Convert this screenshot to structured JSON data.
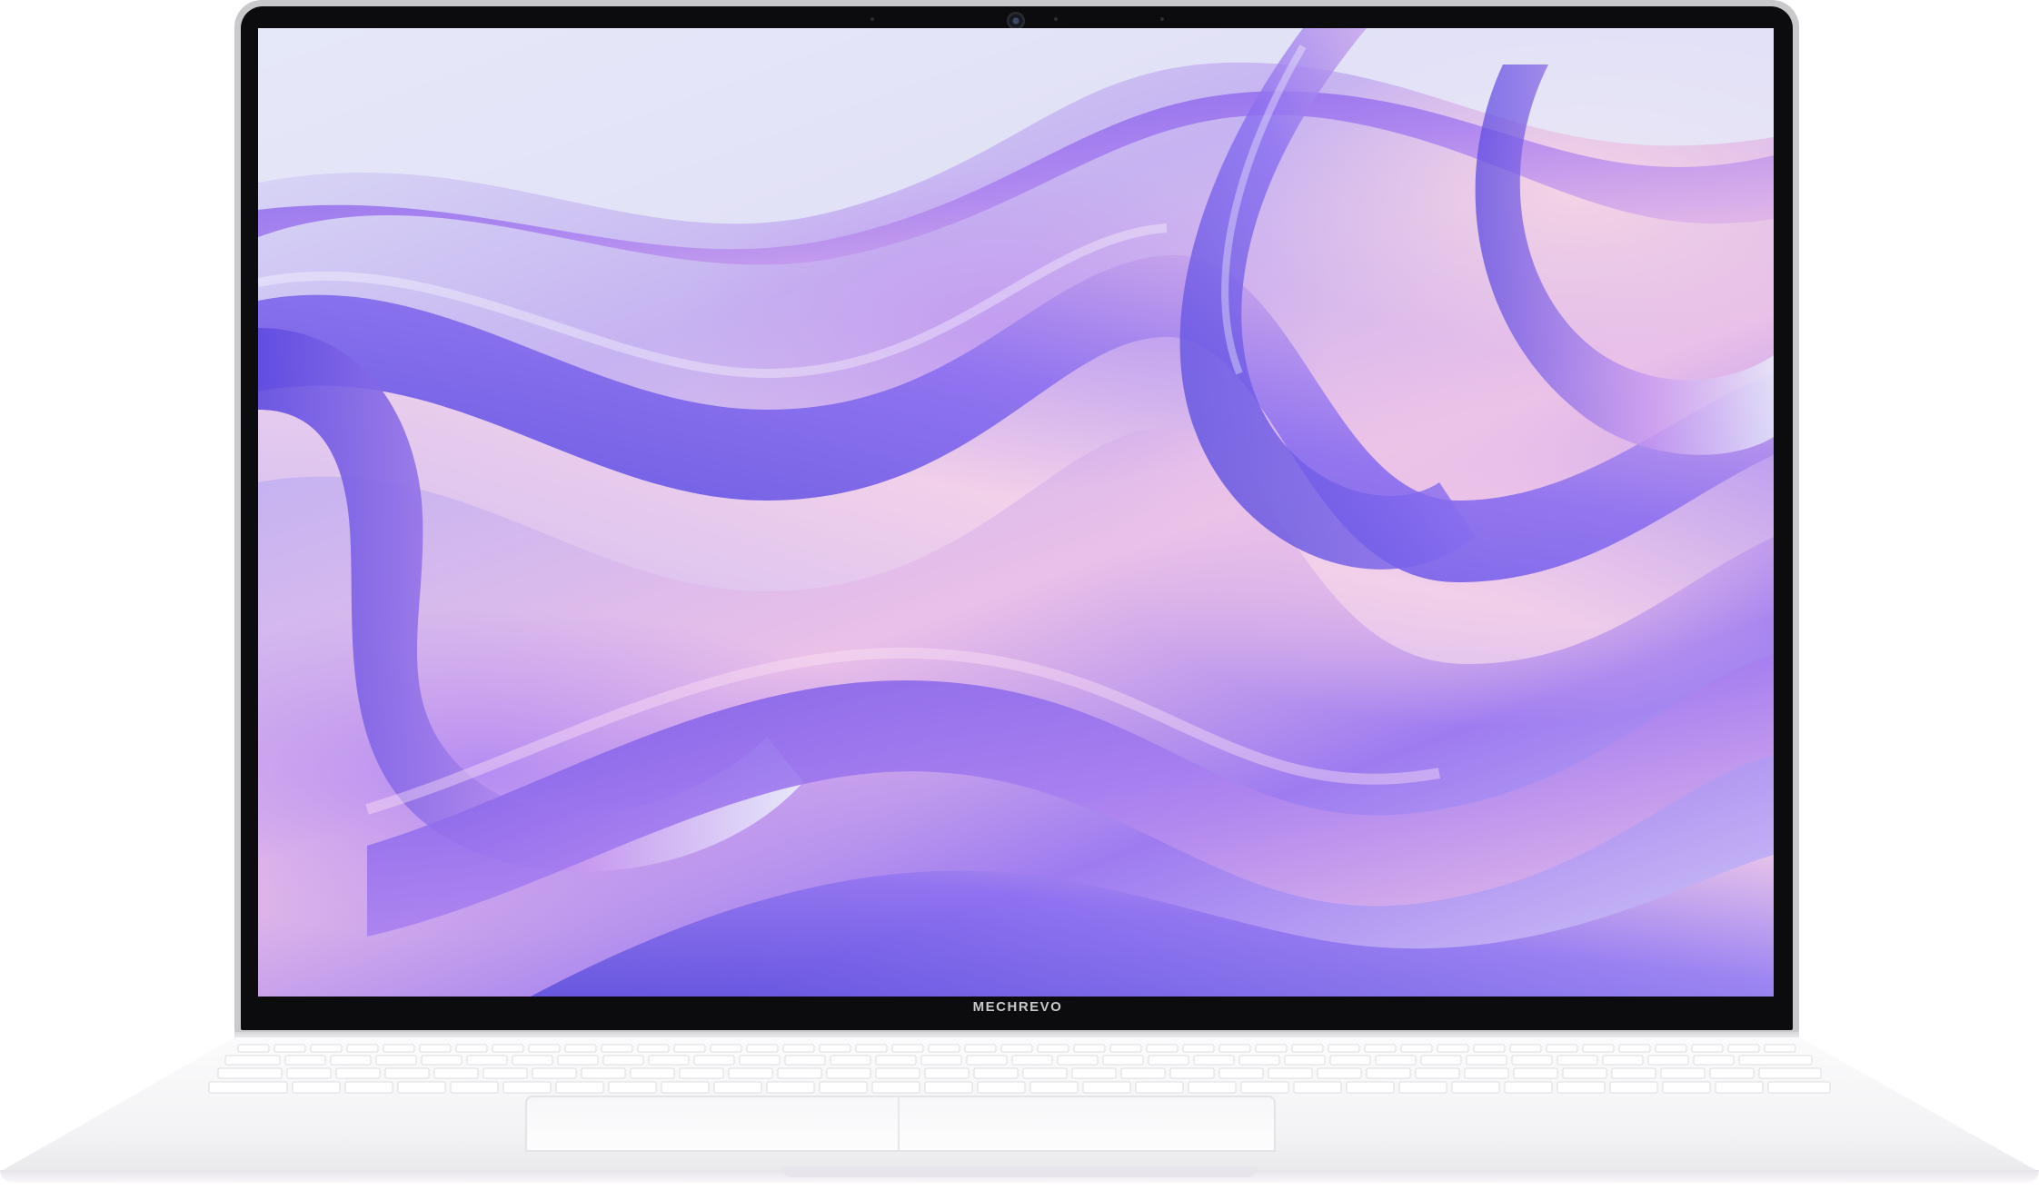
{
  "device": {
    "type": "laptop",
    "brand_logo": "MECHREVO",
    "color": "white"
  },
  "screen": {
    "wallpaper": "abstract-iridescent-waves",
    "palette": [
      "#7c55e8",
      "#b58cf2",
      "#f0c7e8",
      "#dfe4f7",
      "#9e7cf0"
    ]
  },
  "colors": {
    "bezel": "#0c0c0e",
    "chassis": "#f3f3f5",
    "logo": "#c9c9cc"
  }
}
